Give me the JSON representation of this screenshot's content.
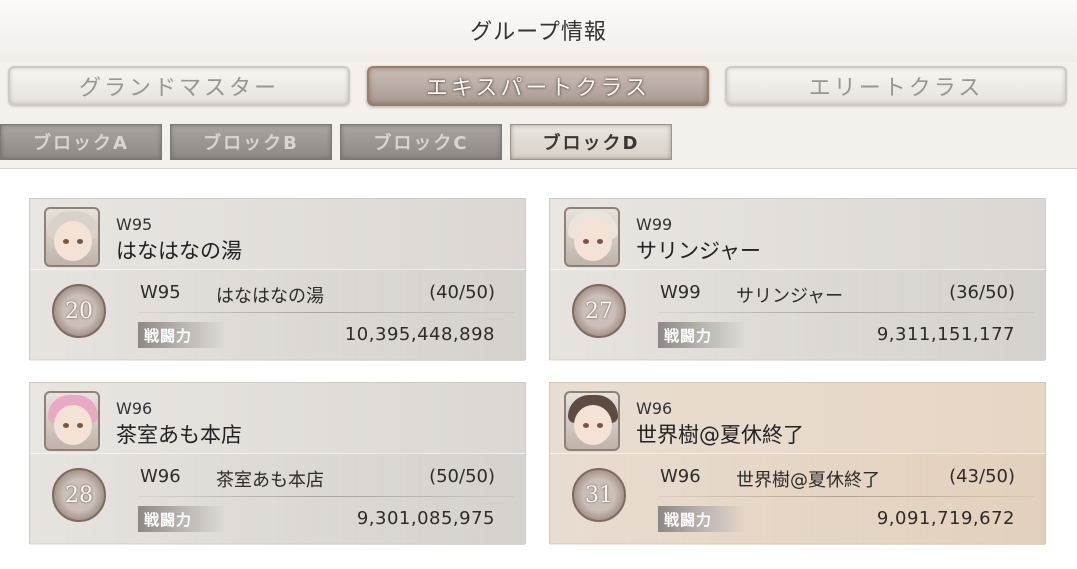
{
  "header": {
    "title": "グループ情報"
  },
  "class_tabs": [
    {
      "label": "グランドマスター",
      "active": false
    },
    {
      "label": "エキスパートクラス",
      "active": true
    },
    {
      "label": "エリートクラス",
      "active": false
    }
  ],
  "block_tabs": [
    {
      "label": "ブロックA",
      "active": false
    },
    {
      "label": "ブロックB",
      "active": false
    },
    {
      "label": "ブロックC",
      "active": false
    },
    {
      "label": "ブロックD",
      "active": true
    }
  ],
  "power_label": "戦闘力",
  "cards": [
    {
      "server": "W95",
      "name": "はなはなの湯",
      "rank": "20",
      "count": "(40/50)",
      "power": "10,395,448,898",
      "highlighted": false
    },
    {
      "server": "W99",
      "name": "サリンジャー",
      "rank": "27",
      "count": "(36/50)",
      "power": "9,311,151,177",
      "highlighted": false
    },
    {
      "server": "W96",
      "name": "茶室あも本店",
      "rank": "28",
      "count": "(50/50)",
      "power": "9,301,085,975",
      "highlighted": false
    },
    {
      "server": "W96",
      "name": "世界樹@夏休終了",
      "rank": "31",
      "count": "(43/50)",
      "power": "9,091,719,672",
      "highlighted": true
    }
  ],
  "colors": {
    "active_tab": "#a99a92",
    "highlight_card": "#e6d6c4",
    "rank_medal": "#a6958b"
  }
}
